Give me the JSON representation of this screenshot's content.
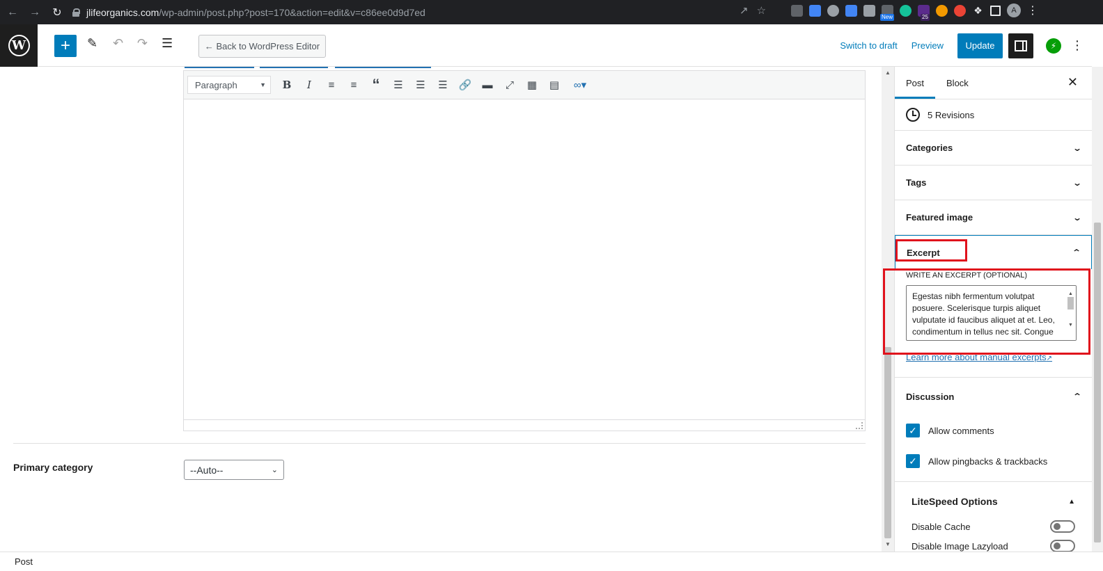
{
  "browser": {
    "url_host": "jlifeorganics.com",
    "url_path": "/wp-admin/post.php?post=170&action=edit&v=c86ee0d9d7ed",
    "ext_badge_new": "New",
    "ext_badge_count": "25",
    "avatar_letter": "A"
  },
  "header": {
    "back_label": "← Back to WordPress Editor",
    "switch_draft": "Switch to draft",
    "preview": "Preview",
    "update": "Update"
  },
  "editor": {
    "format_select": "Paragraph",
    "primary_category_label": "Primary category",
    "primary_category_value": "--Auto--"
  },
  "sidebar": {
    "tab_post": "Post",
    "tab_block": "Block",
    "revisions": "5 Revisions",
    "panels": {
      "categories": "Categories",
      "tags": "Tags",
      "featured_image": "Featured image",
      "excerpt": "Excerpt"
    },
    "excerpt_label": "WRITE AN EXCERPT (OPTIONAL)",
    "excerpt_text": "Egestas nibh fermentum volutpat posuere. Scelerisque turpis aliquet vulputate id faucibus aliquet at et. Leo, condimentum in tellus nec sit. Congue nisl, massa vestibulum",
    "learn_more": "Learn more about manual excerpts",
    "discussion": "Discussion",
    "allow_comments": "Allow comments",
    "allow_pingbacks": "Allow pingbacks & trackbacks",
    "litespeed_title": "LiteSpeed Options",
    "disable_cache": "Disable Cache",
    "disable_lazyload": "Disable Image Lazyload"
  },
  "footer": {
    "breadcrumb": "Post"
  },
  "colors": {
    "accent": "#007cba",
    "highlight": "#e0121c",
    "chrome_bar": "#202124"
  }
}
